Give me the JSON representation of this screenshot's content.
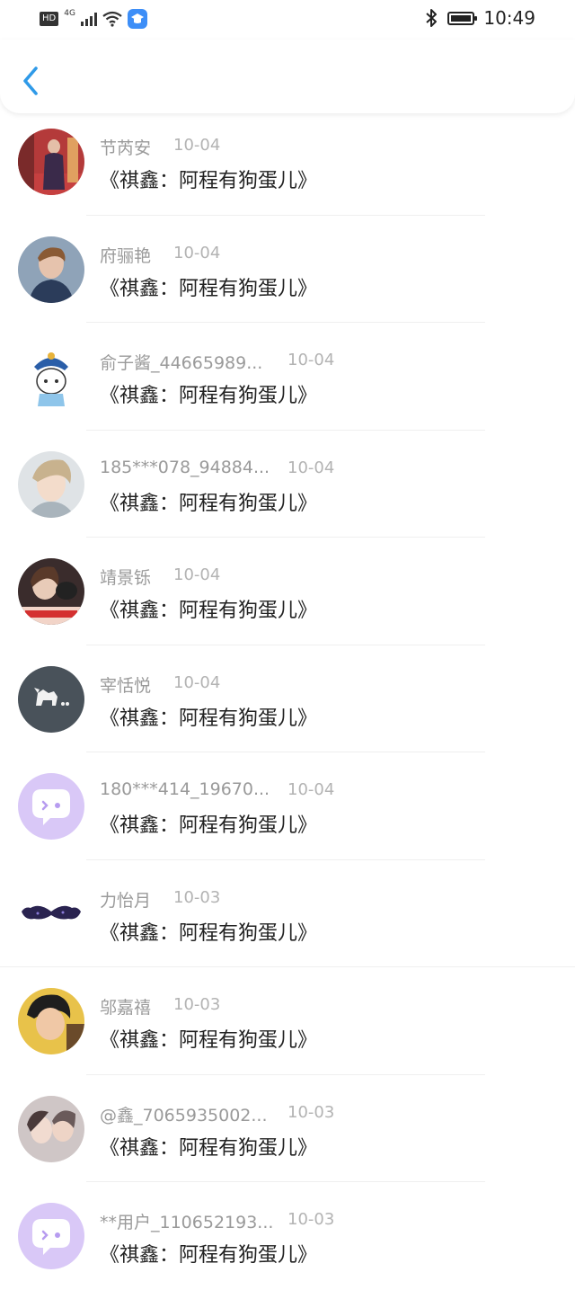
{
  "status_bar": {
    "left_badge": "HD",
    "network": "4G",
    "time": "10:49"
  },
  "list": [
    {
      "name": "节芮安",
      "date": "10-04",
      "title": "《祺鑫：阿程有狗蛋儿》"
    },
    {
      "name": "府骊艳",
      "date": "10-04",
      "title": "《祺鑫：阿程有狗蛋儿》"
    },
    {
      "name": "俞子酱_44665989...",
      "date": "10-04",
      "title": "《祺鑫：阿程有狗蛋儿》"
    },
    {
      "name": "185***078_94884...",
      "date": "10-04",
      "title": "《祺鑫：阿程有狗蛋儿》"
    },
    {
      "name": "靖景铄",
      "date": "10-04",
      "title": "《祺鑫：阿程有狗蛋儿》"
    },
    {
      "name": "宰恬悦",
      "date": "10-04",
      "title": "《祺鑫：阿程有狗蛋儿》"
    },
    {
      "name": "180***414_19670...",
      "date": "10-04",
      "title": "《祺鑫：阿程有狗蛋儿》"
    },
    {
      "name": "力怡月",
      "date": "10-03",
      "title": "《祺鑫：阿程有狗蛋儿》"
    },
    {
      "name": "邬嘉禧",
      "date": "10-03",
      "title": "《祺鑫：阿程有狗蛋儿》"
    },
    {
      "name": "@鑫_7065935002...",
      "date": "10-03",
      "title": "《祺鑫：阿程有狗蛋儿》"
    },
    {
      "name": "**用户_110652193...",
      "date": "10-03",
      "title": "《祺鑫：阿程有狗蛋儿》"
    }
  ],
  "colors": {
    "accent": "#2f9ae8",
    "name_gray": "#9a9a9a",
    "date_gray": "#b3b3b3",
    "title": "#222222",
    "default_avatar": "#d9c8f7"
  }
}
